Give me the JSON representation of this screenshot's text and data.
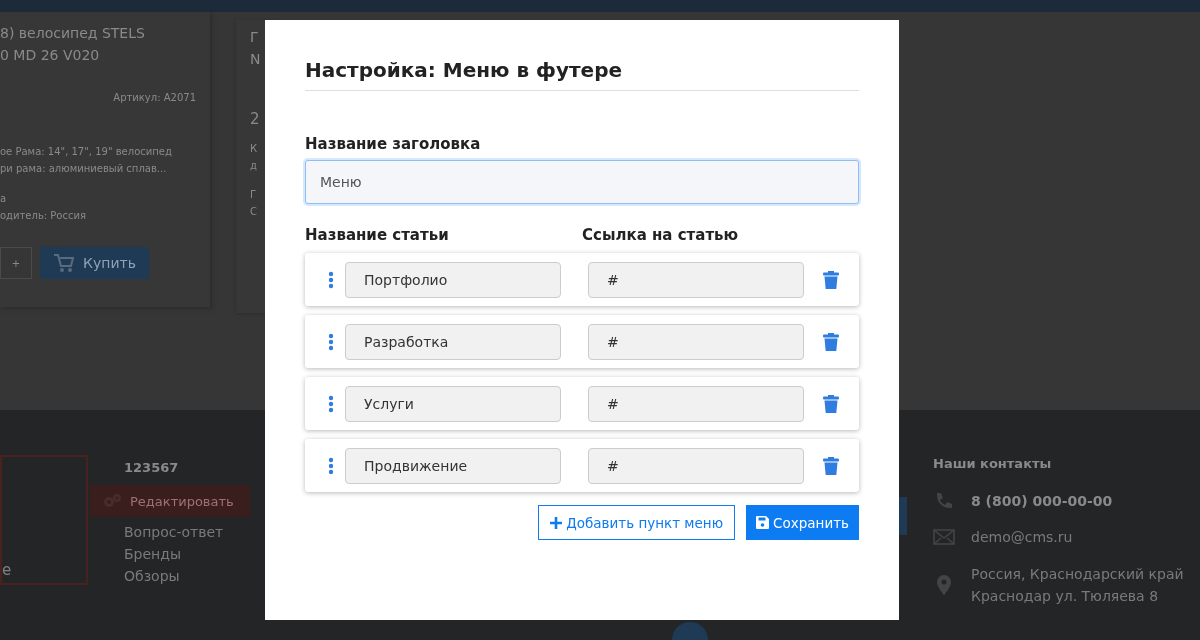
{
  "background": {
    "product_card": {
      "title_lines": [
        "8) велосипед STELS",
        "0 MD 26 V020"
      ],
      "sku": "Артикул: A2071",
      "description_lines": [
        "ое Рама: 14\", 17\", 19\" велосипед",
        "ри рама: алюминиевый сплав..."
      ],
      "properties": [
        "а",
        "одитель: Россия"
      ],
      "quantity_plus": "+",
      "buy_button": "Купить"
    },
    "product_card_2": {
      "texts": [
        "Г",
        "N",
        "2",
        "К",
        "д",
        "Г",
        "С"
      ]
    },
    "footer": {
      "box_text": "е",
      "column_title": "123567",
      "edit_button": "Редактировать",
      "links": [
        "Вопрос-ответ",
        "Бренды",
        "Обзоры"
      ],
      "contacts": {
        "title": "Наши контакты",
        "phone": "8 (800) 000-00-00",
        "email": "demo@cms.ru",
        "address_lines": [
          "Россия, Краснодарский край",
          "Краснодар ул. Тюляева 8"
        ]
      }
    }
  },
  "modal": {
    "title": "Настройка: Меню в футере",
    "heading_label": "Название заголовка",
    "heading_field": {
      "value": "Меню"
    },
    "columns": [
      "Название статьи",
      "Ссылка на статью"
    ],
    "items": [
      {
        "title": "Портфолио",
        "link": "#"
      },
      {
        "title": "Разработка",
        "link": "#"
      },
      {
        "title": "Услуги",
        "link": "#"
      },
      {
        "title": "Продвижение",
        "link": "#"
      }
    ],
    "add_button": "Добавить пункт меню",
    "save_button": "Сохранить"
  }
}
